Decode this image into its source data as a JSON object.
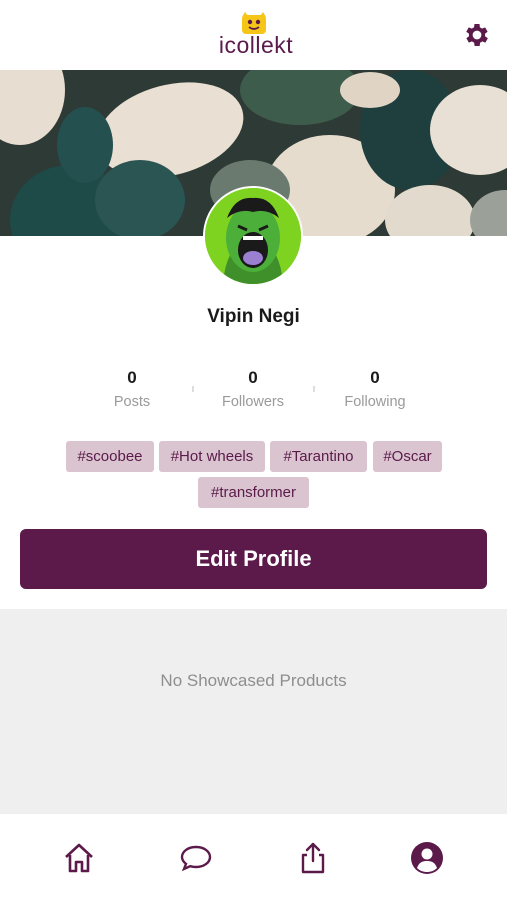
{
  "app": {
    "name": "icollekt"
  },
  "colors": {
    "primary": "#5b1a4a",
    "tag_bg": "#d9c4d0",
    "showcase_bg": "#efefef"
  },
  "header": {
    "logo_text": "icollekt",
    "settings_icon": "gear-icon"
  },
  "profile": {
    "name": "Vipin Negi",
    "stats": [
      {
        "value": "0",
        "label": "Posts"
      },
      {
        "value": "0",
        "label": "Followers"
      },
      {
        "value": "0",
        "label": "Following"
      }
    ],
    "tags": [
      "#scoobee",
      "#Hot wheels",
      "#Tarantino",
      "#Oscar",
      "#transformer"
    ],
    "edit_button_label": "Edit Profile"
  },
  "showcase": {
    "empty_text": "No Showcased Products"
  },
  "bottom_nav": {
    "items": [
      {
        "icon": "home-icon"
      },
      {
        "icon": "chat-bubble-icon"
      },
      {
        "icon": "share-icon"
      },
      {
        "icon": "profile-icon",
        "active": true
      }
    ]
  }
}
